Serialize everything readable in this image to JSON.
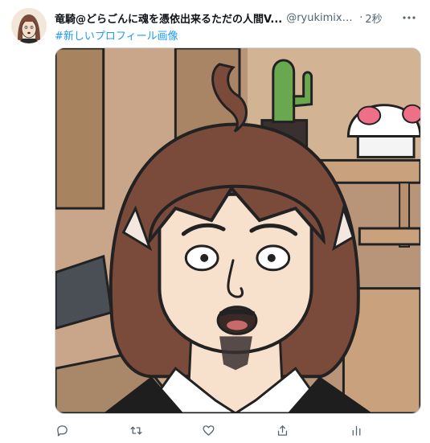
{
  "tweet": {
    "display_name": "竜騎@どらごんに魂を憑依出来るただの人間V...",
    "handle": "@ryukimixVtu...",
    "separator": "·",
    "time": "2秒",
    "hashtag": "#新しいプロフィール画像"
  },
  "icons": {
    "more": "more-horizontal-icon",
    "reply": "reply-icon",
    "retweet": "retweet-icon",
    "like": "like-icon",
    "share": "share-icon",
    "analytics": "analytics-icon"
  },
  "colors": {
    "link": "#1d9bf0",
    "secondary_text": "#536471",
    "border": "#cfd9de"
  }
}
